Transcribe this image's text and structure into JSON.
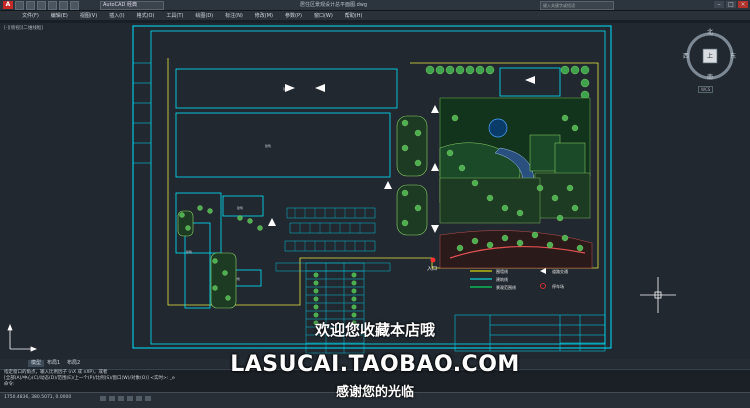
{
  "titlebar": {
    "app_icon": "A",
    "workspace": "AutoCAD 经典",
    "title": "居住区景观设计总平面图.dwg",
    "search_placeholder": "键入关键字或短语"
  },
  "menu": [
    "文件(F)",
    "编辑(E)",
    "视图(V)",
    "插入(I)",
    "格式(O)",
    "工具(T)",
    "绘图(D)",
    "标注(N)",
    "修改(M)",
    "参数(P)",
    "窗口(W)",
    "帮助(H)"
  ],
  "viewport_label": "[-][俯视][二维线框]",
  "viewcube": {
    "north": "北",
    "south": "南",
    "east": "东",
    "west": "西",
    "center": "上",
    "wcs": "WCS"
  },
  "drawing": {
    "entrance_label": "入口",
    "legend": [
      {
        "label": "围墙线",
        "color": "#ffff00"
      },
      {
        "label": "建筑线",
        "color": "#00ffff"
      },
      {
        "label": "景观范围线",
        "color": "#00ff66"
      }
    ],
    "legend2": [
      {
        "label": "道路交通",
        "icon": "arrow-icon"
      },
      {
        "label": "停车场",
        "icon": "parking-icon"
      }
    ],
    "building_label": "建筑"
  },
  "tabs": [
    "模型",
    "布局1",
    "布局2"
  ],
  "command_lines": [
    "指定窗口的角点，输入比例因子 (nX 或 nXP)，或者",
    "[全部(A)/中心(C)/动态(D)/范围(E)/上一个(P)/比例(S)/窗口(W)/对象(O)] <实时>: _e",
    "命令:"
  ],
  "status_coords": "1750.4836, 380.5071, 0.0000",
  "overlay": {
    "line1": "欢迎您收藏本店哦",
    "line2": "LASUCAI.TAOBAO.COM",
    "line3": "感谢您的光临"
  },
  "colors": {
    "accent": "#00ffff",
    "wall": "#ffff00",
    "tree": "#3fa34d"
  }
}
